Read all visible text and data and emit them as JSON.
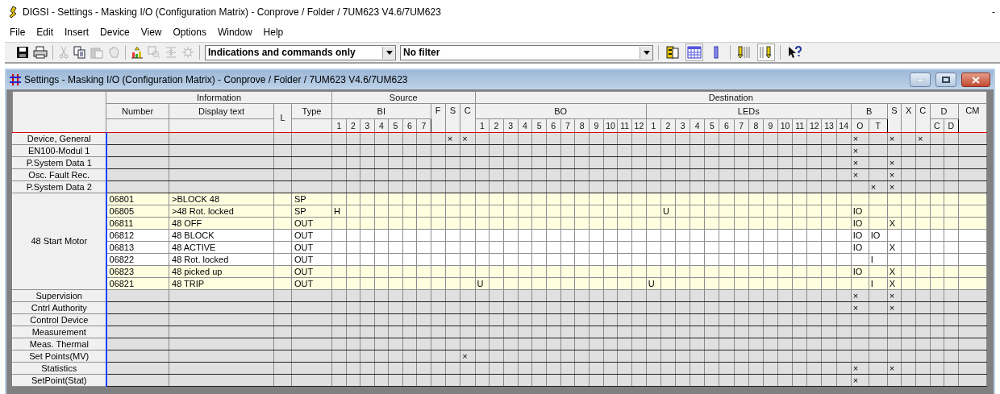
{
  "app_title": "DIGSI - Settings - Masking I/O (Configuration Matrix) - Conprove / Folder / 7UM623 V4.6/7UM623",
  "app_controls": [
    "-"
  ],
  "menu": [
    "File",
    "Edit",
    "Insert",
    "Device",
    "View",
    "Options",
    "Window",
    "Help"
  ],
  "toolbar": {
    "left_buttons": [
      {
        "disabled": false
      },
      {
        "disabled": false
      },
      {
        "disabled": true
      },
      {
        "disabled": false
      },
      {
        "disabled": true
      },
      {
        "disabled": true
      },
      {
        "disabled": false
      },
      {
        "disabled": true
      },
      {
        "disabled": true
      },
      {
        "disabled": true
      }
    ],
    "view_dropdown": {
      "value": "Indications and commands only"
    },
    "filter_dropdown": {
      "value": "No filter"
    },
    "right_buttons": [
      {
        "pressed": false
      },
      {
        "pressed": true
      },
      {
        "pressed": false
      },
      {
        "pressed": false
      },
      {
        "pressed": true
      },
      {
        "pressed": false
      }
    ]
  },
  "document_window": {
    "title": "Settings - Masking I/O (Configuration Matrix) - Conprove / Folder / 7UM623 V4.6/7UM623"
  },
  "matrix": {
    "information": {
      "label": "Information",
      "columns": [
        {
          "label": "Number",
          "kind": "split"
        },
        {
          "label": "Display text",
          "kind": "split"
        },
        {
          "label": "L",
          "kind": "full"
        },
        {
          "label": "Type",
          "kind": "split"
        }
      ]
    },
    "sections": [
      {
        "label": "Source",
        "groups": [
          {
            "label": "BI",
            "columns": [
              "1",
              "2",
              "3",
              "4",
              "5",
              "6",
              "7"
            ]
          },
          {
            "label": "F"
          },
          {
            "label": "S"
          },
          {
            "label": "C"
          }
        ]
      },
      {
        "label": "Destination",
        "groups": [
          {
            "label": "BO",
            "columns": [
              "1",
              "2",
              "3",
              "4",
              "5",
              "6",
              "7",
              "8",
              "9",
              "10",
              "11",
              "12"
            ]
          },
          {
            "label": "LEDs",
            "columns": [
              "1",
              "2",
              "3",
              "4",
              "5",
              "6",
              "7",
              "8",
              "9",
              "10",
              "11",
              "12",
              "13",
              "14"
            ]
          },
          {
            "label": "B",
            "columns": [
              "O",
              "T"
            ]
          },
          {
            "label": "S"
          },
          {
            "label": "X"
          },
          {
            "label": "C"
          },
          {
            "label": "D",
            "columns": [
              "C",
              "D"
            ]
          },
          {
            "label": "CM"
          }
        ]
      }
    ],
    "groups": [
      {
        "label": "Device, General",
        "expanded": false,
        "cells": [
          null,
          null,
          null,
          null,
          null,
          null,
          null,
          null,
          "×",
          "×",
          null,
          null,
          null,
          null,
          null,
          null,
          null,
          null,
          null,
          null,
          null,
          null,
          null,
          null,
          null,
          null,
          null,
          null,
          null,
          null,
          null,
          null,
          null,
          null,
          null,
          null,
          "×",
          null,
          "×",
          null,
          "×",
          null,
          null,
          null
        ]
      },
      {
        "label": "EN100-Modul 1",
        "expanded": false,
        "cells": [
          null,
          null,
          null,
          null,
          null,
          null,
          null,
          null,
          null,
          null,
          null,
          null,
          null,
          null,
          null,
          null,
          null,
          null,
          null,
          null,
          null,
          null,
          null,
          null,
          null,
          null,
          null,
          null,
          null,
          null,
          null,
          null,
          null,
          null,
          null,
          null,
          "×",
          null,
          null,
          null,
          null,
          null,
          null,
          null
        ]
      },
      {
        "label": "P.System Data 1",
        "expanded": false,
        "cells": [
          null,
          null,
          null,
          null,
          null,
          null,
          null,
          null,
          null,
          null,
          null,
          null,
          null,
          null,
          null,
          null,
          null,
          null,
          null,
          null,
          null,
          null,
          null,
          null,
          null,
          null,
          null,
          null,
          null,
          null,
          null,
          null,
          null,
          null,
          null,
          null,
          "×",
          null,
          "×",
          null,
          null,
          null,
          null,
          null
        ]
      },
      {
        "label": "Osc. Fault Rec.",
        "expanded": false,
        "cells": [
          null,
          null,
          null,
          null,
          null,
          null,
          null,
          null,
          null,
          null,
          null,
          null,
          null,
          null,
          null,
          null,
          null,
          null,
          null,
          null,
          null,
          null,
          null,
          null,
          null,
          null,
          null,
          null,
          null,
          null,
          null,
          null,
          null,
          null,
          null,
          null,
          "×",
          null,
          "×",
          null,
          null,
          null,
          null,
          null
        ]
      },
      {
        "label": "P.System Data 2",
        "expanded": false,
        "cells": [
          null,
          null,
          null,
          null,
          null,
          null,
          null,
          null,
          null,
          null,
          null,
          null,
          null,
          null,
          null,
          null,
          null,
          null,
          null,
          null,
          null,
          null,
          null,
          null,
          null,
          null,
          null,
          null,
          null,
          null,
          null,
          null,
          null,
          null,
          null,
          null,
          null,
          "×",
          "×",
          null,
          null,
          null,
          null,
          null
        ]
      },
      {
        "label": "48 Start Motor",
        "expanded": true,
        "rows": [
          {
            "number": "06801",
            "text": ">BLOCK 48",
            "type": "SP",
            "highlighted": true
          },
          {
            "number": "06805",
            "text": ">48 Rot. locked",
            "type": "SP",
            "highlighted": true,
            "cells": [
              "H",
              null,
              null,
              null,
              null,
              null,
              null,
              null,
              null,
              null,
              null,
              null,
              null,
              null,
              null,
              null,
              null,
              null,
              null,
              null,
              null,
              null,
              null,
              "U",
              null,
              null,
              null,
              null,
              null,
              null,
              null,
              null,
              null,
              null,
              null,
              null,
              "IO",
              null,
              null,
              null,
              null,
              null,
              null,
              null
            ]
          },
          {
            "number": "06811",
            "text": "48 OFF",
            "type": "OUT",
            "highlighted": true,
            "cells": [
              null,
              null,
              null,
              null,
              null,
              null,
              null,
              null,
              null,
              null,
              null,
              null,
              null,
              null,
              null,
              null,
              null,
              null,
              null,
              null,
              null,
              null,
              null,
              null,
              null,
              null,
              null,
              null,
              null,
              null,
              null,
              null,
              null,
              null,
              null,
              null,
              "IO",
              null,
              "X",
              null,
              null,
              null,
              null,
              null
            ]
          },
          {
            "number": "06812",
            "text": "48 BLOCK",
            "type": "OUT",
            "highlighted": false,
            "cells": [
              null,
              null,
              null,
              null,
              null,
              null,
              null,
              null,
              null,
              null,
              null,
              null,
              null,
              null,
              null,
              null,
              null,
              null,
              null,
              null,
              null,
              null,
              null,
              null,
              null,
              null,
              null,
              null,
              null,
              null,
              null,
              null,
              null,
              null,
              null,
              null,
              "IO",
              "IO",
              null,
              null,
              null,
              null,
              null,
              null
            ]
          },
          {
            "number": "06813",
            "text": "48 ACTIVE",
            "type": "OUT",
            "highlighted": false,
            "cells": [
              null,
              null,
              null,
              null,
              null,
              null,
              null,
              null,
              null,
              null,
              null,
              null,
              null,
              null,
              null,
              null,
              null,
              null,
              null,
              null,
              null,
              null,
              null,
              null,
              null,
              null,
              null,
              null,
              null,
              null,
              null,
              null,
              null,
              null,
              null,
              null,
              "IO",
              null,
              "X",
              null,
              null,
              null,
              null,
              null
            ]
          },
          {
            "number": "06822",
            "text": "48 Rot. locked",
            "type": "OUT",
            "highlighted": false,
            "cells": [
              null,
              null,
              null,
              null,
              null,
              null,
              null,
              null,
              null,
              null,
              null,
              null,
              null,
              null,
              null,
              null,
              null,
              null,
              null,
              null,
              null,
              null,
              null,
              null,
              null,
              null,
              null,
              null,
              null,
              null,
              null,
              null,
              null,
              null,
              null,
              null,
              null,
              "I",
              null,
              null,
              null,
              null,
              null,
              null
            ]
          },
          {
            "number": "06823",
            "text": "48 picked up",
            "type": "OUT",
            "highlighted": true,
            "cells": [
              null,
              null,
              null,
              null,
              null,
              null,
              null,
              null,
              null,
              null,
              null,
              null,
              null,
              null,
              null,
              null,
              null,
              null,
              null,
              null,
              null,
              null,
              null,
              null,
              null,
              null,
              null,
              null,
              null,
              null,
              null,
              null,
              null,
              null,
              null,
              null,
              "IO",
              null,
              "X",
              null,
              null,
              null,
              null,
              null
            ]
          },
          {
            "number": "06821",
            "text": "48 TRIP",
            "type": "OUT",
            "highlighted": true,
            "cells": [
              null,
              null,
              null,
              null,
              null,
              null,
              null,
              null,
              null,
              null,
              "U",
              null,
              null,
              null,
              null,
              null,
              null,
              null,
              null,
              null,
              null,
              null,
              "U",
              null,
              null,
              null,
              null,
              null,
              null,
              null,
              null,
              null,
              null,
              null,
              null,
              null,
              null,
              "I",
              "X",
              null,
              null,
              null,
              null,
              null
            ]
          }
        ]
      },
      {
        "label": "Supervision",
        "expanded": false,
        "cells": [
          null,
          null,
          null,
          null,
          null,
          null,
          null,
          null,
          null,
          null,
          null,
          null,
          null,
          null,
          null,
          null,
          null,
          null,
          null,
          null,
          null,
          null,
          null,
          null,
          null,
          null,
          null,
          null,
          null,
          null,
          null,
          null,
          null,
          null,
          null,
          null,
          "×",
          null,
          "×",
          null,
          null,
          null,
          null,
          null
        ]
      },
      {
        "label": "Cntrl Authority",
        "expanded": false,
        "cells": [
          null,
          null,
          null,
          null,
          null,
          null,
          null,
          null,
          null,
          null,
          null,
          null,
          null,
          null,
          null,
          null,
          null,
          null,
          null,
          null,
          null,
          null,
          null,
          null,
          null,
          null,
          null,
          null,
          null,
          null,
          null,
          null,
          null,
          null,
          null,
          null,
          "×",
          null,
          "×",
          null,
          null,
          null,
          null,
          null
        ]
      },
      {
        "label": "Control Device",
        "expanded": false
      },
      {
        "label": "Measurement",
        "expanded": false
      },
      {
        "label": "Meas. Thermal",
        "expanded": false
      },
      {
        "label": "Set Points(MV)",
        "expanded": false,
        "cells": [
          null,
          null,
          null,
          null,
          null,
          null,
          null,
          null,
          null,
          "×",
          null,
          null,
          null,
          null,
          null,
          null,
          null,
          null,
          null,
          null,
          null,
          null,
          null,
          null,
          null,
          null,
          null,
          null,
          null,
          null,
          null,
          null,
          null,
          null,
          null,
          null,
          null,
          null,
          null,
          null,
          null,
          null,
          null,
          null
        ]
      },
      {
        "label": "Statistics",
        "expanded": false,
        "cells": [
          null,
          null,
          null,
          null,
          null,
          null,
          null,
          null,
          null,
          null,
          null,
          null,
          null,
          null,
          null,
          null,
          null,
          null,
          null,
          null,
          null,
          null,
          null,
          null,
          null,
          null,
          null,
          null,
          null,
          null,
          null,
          null,
          null,
          null,
          null,
          null,
          "×",
          null,
          "×",
          null,
          null,
          null,
          null,
          null
        ]
      },
      {
        "label": "SetPoint(Stat)",
        "expanded": false,
        "cells": [
          null,
          null,
          null,
          null,
          null,
          null,
          null,
          null,
          null,
          null,
          null,
          null,
          null,
          null,
          null,
          null,
          null,
          null,
          null,
          null,
          null,
          null,
          null,
          null,
          null,
          null,
          null,
          null,
          null,
          null,
          null,
          null,
          null,
          null,
          null,
          null,
          "×",
          null,
          null,
          null,
          null,
          null,
          null,
          null
        ]
      }
    ]
  }
}
